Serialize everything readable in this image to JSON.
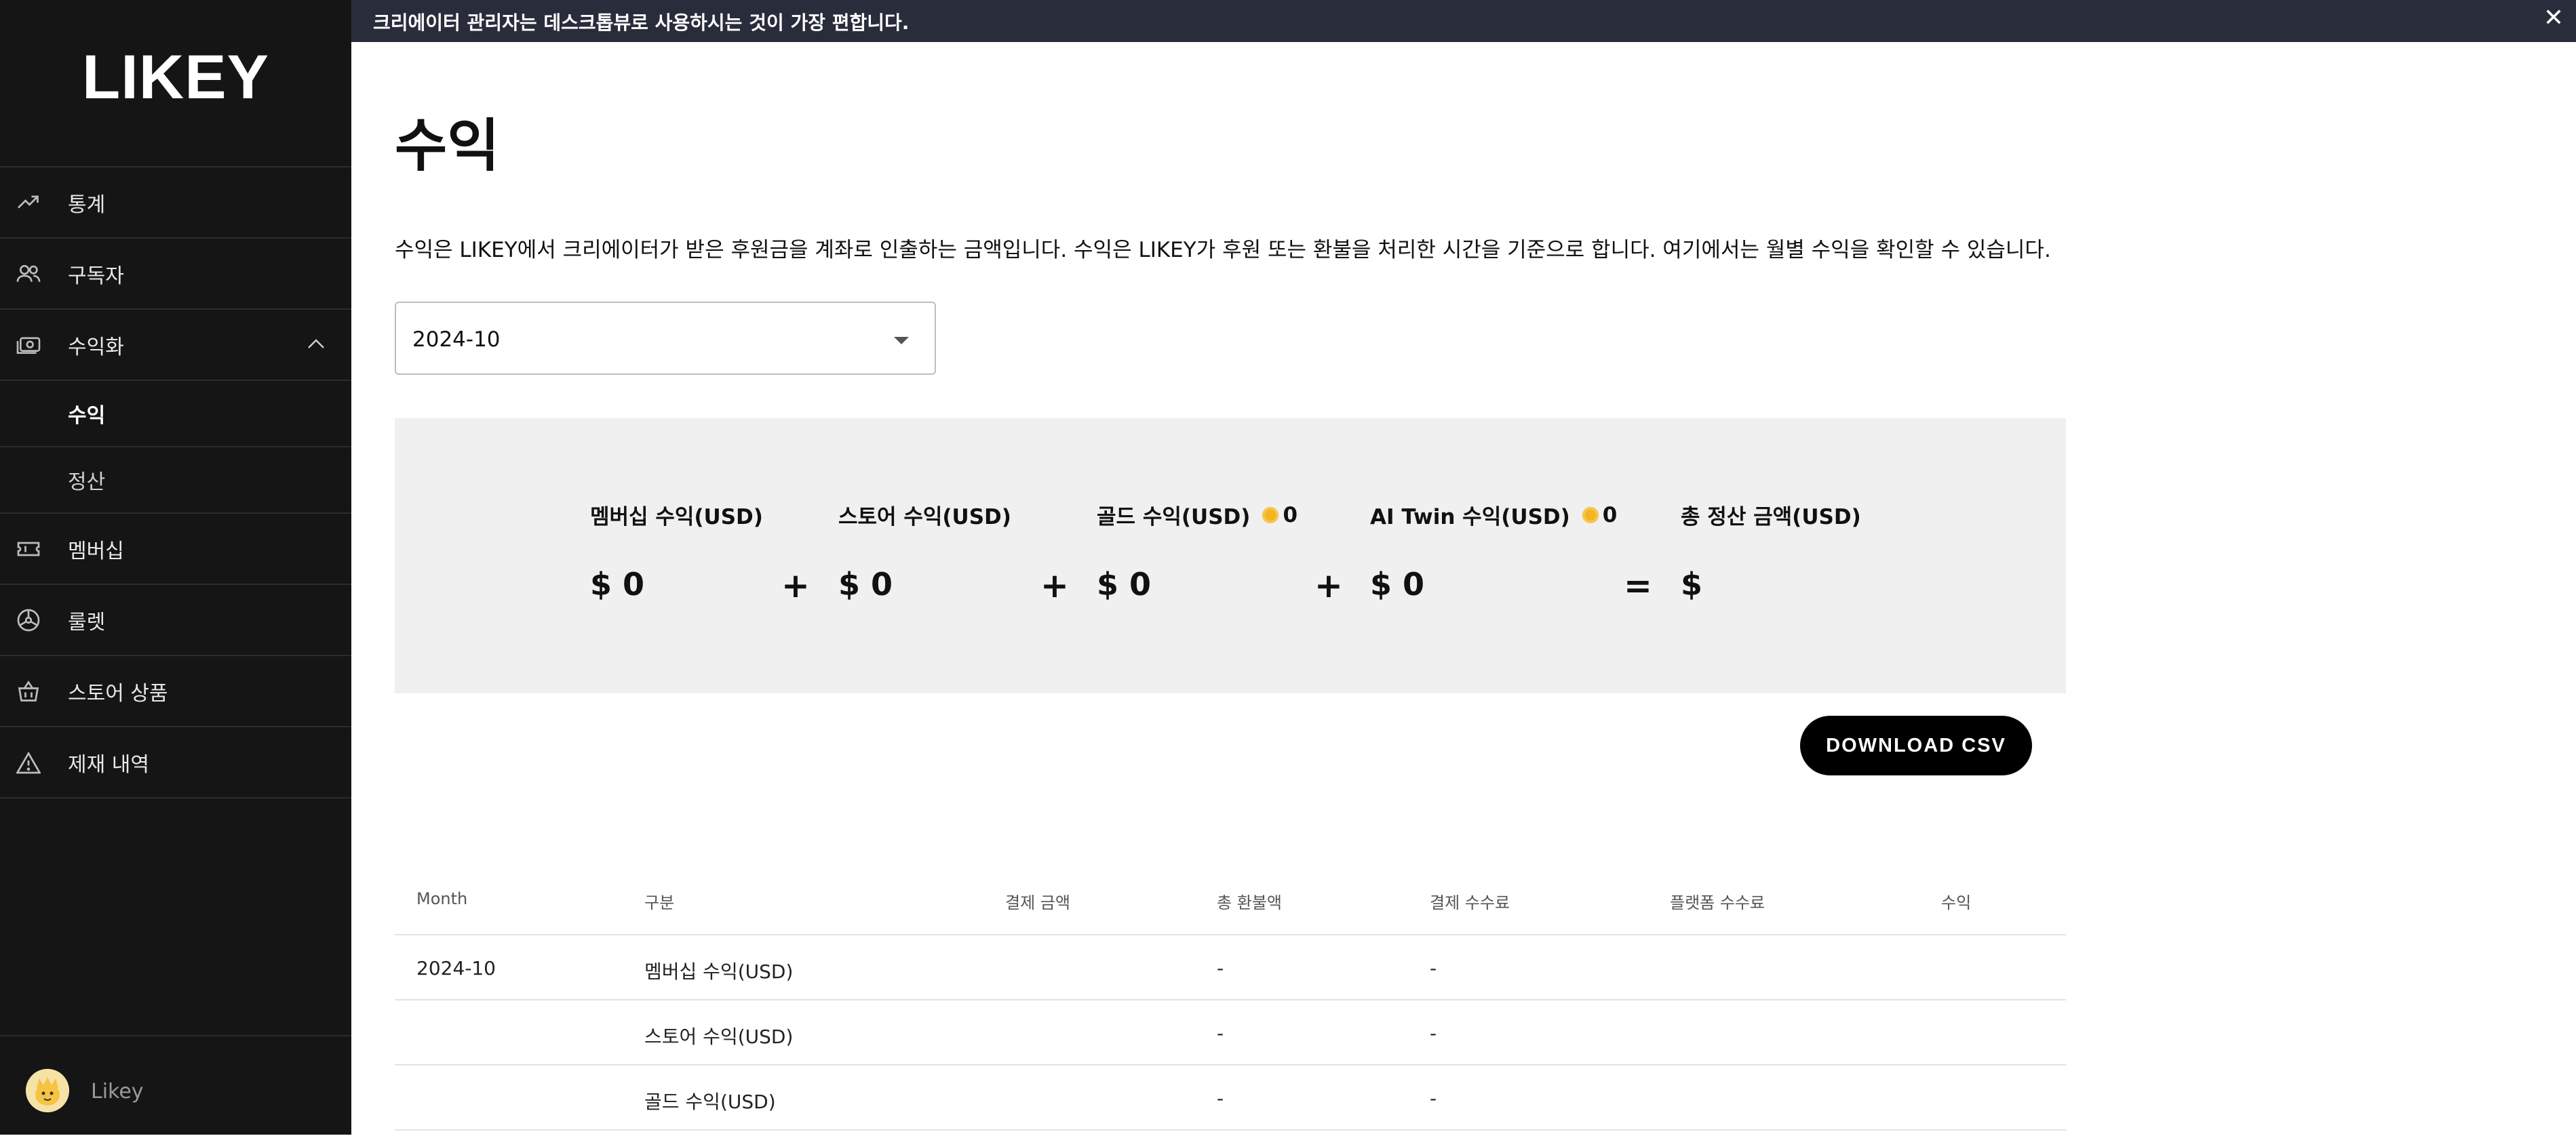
{
  "sidebar": {
    "logo": "LIKEY",
    "items": [
      {
        "label": "통계",
        "icon": "trending-up-icon"
      },
      {
        "label": "구독자",
        "icon": "users-icon"
      },
      {
        "label": "수익화",
        "icon": "money-icon"
      },
      {
        "label": "수익",
        "sub": true,
        "active": true
      },
      {
        "label": "정산",
        "sub": true
      },
      {
        "label": "멤버십",
        "icon": "ticket-icon"
      },
      {
        "label": "룰렛",
        "icon": "roulette-icon"
      },
      {
        "label": "스토어 상품",
        "icon": "basket-icon"
      },
      {
        "label": "제재 내역",
        "icon": "warning-icon"
      }
    ],
    "user": {
      "name": "Likey"
    }
  },
  "banner": {
    "text": "크리에이터 관리자는 데스크톱뷰로 사용하시는 것이 가장 편합니다.",
    "close": "✕"
  },
  "page": {
    "title": "수익",
    "description": "수익은 LIKEY에서 크리에이터가 받은 후원금을 계좌로 인출하는 금액입니다. 수익은 LIKEY가 후원 또는 환불을 처리한 시간을 기준으로 합니다. 여기에서는 월별 수익을 확인할 수 있습니다."
  },
  "month_select": {
    "value": "2024-10"
  },
  "summary": {
    "membership": {
      "label": "멤버십 수익(USD)",
      "value": "$ 0"
    },
    "store": {
      "label": "스토어 수익(USD)",
      "value": "$ 0"
    },
    "gold": {
      "label": "골드 수익(USD)",
      "value": "$ 0",
      "coins": "0"
    },
    "aitwin": {
      "label": "AI Twin 수익(USD)",
      "value": "$ 0",
      "coins": "0"
    },
    "total": {
      "label": "총 정산 금액(USD)",
      "value": "$"
    },
    "plus": "+",
    "equals": "="
  },
  "csv_button": "DOWNLOAD CSV",
  "table": {
    "headers": [
      "Month",
      "구분",
      "결제 금액",
      "총 환불액",
      "결제 수수료",
      "플랫폼 수수료",
      "수익"
    ],
    "rows": [
      [
        "2024-10",
        "멤버십 수익(USD)",
        "",
        "-",
        "-",
        "",
        ""
      ],
      [
        "",
        "스토어 수익(USD)",
        "",
        "-",
        "-",
        "",
        ""
      ],
      [
        "",
        "골드 수익(USD)",
        "",
        "-",
        "-",
        "",
        ""
      ]
    ]
  }
}
